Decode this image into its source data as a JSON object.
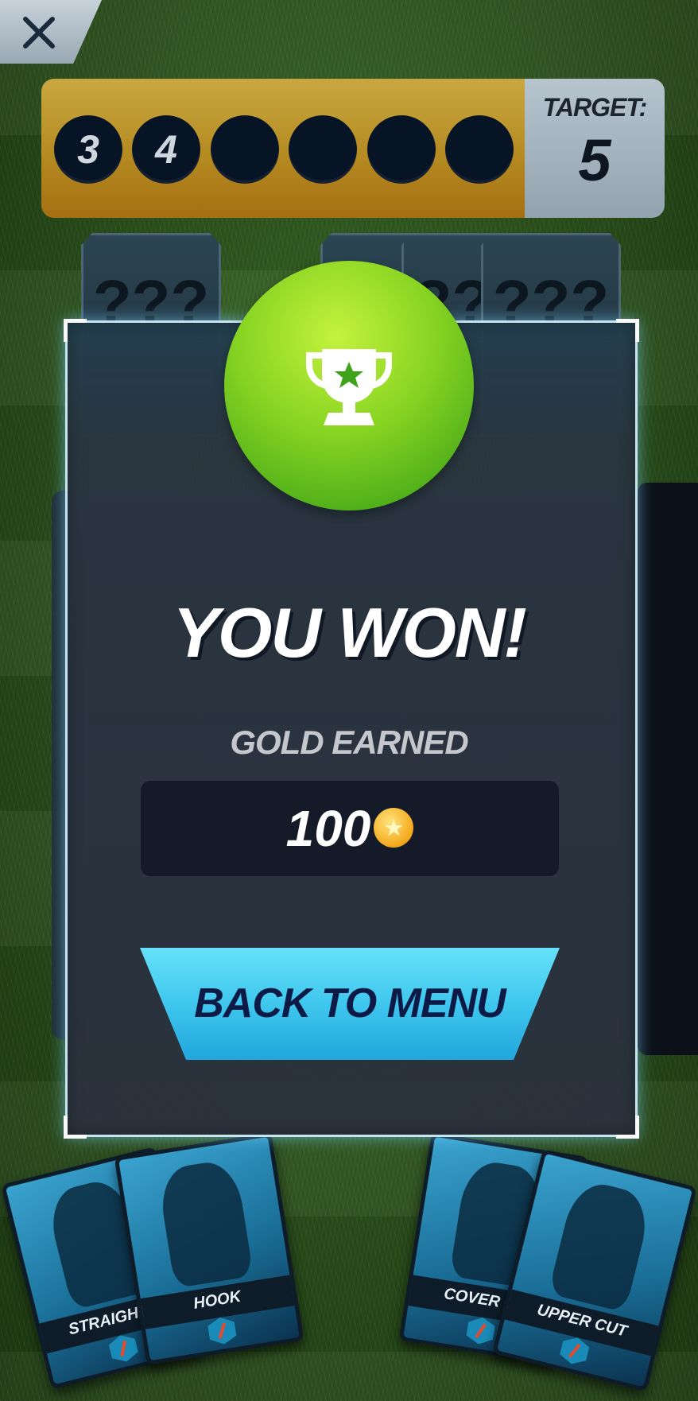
{
  "score_bar": {
    "balls": [
      "3",
      "4",
      "",
      "",
      "",
      ""
    ],
    "target_label": "TARGET:",
    "target_value": "5"
  },
  "hidden_cards": [
    "???",
    "???",
    "???",
    "???"
  ],
  "modal": {
    "title": "YOU WON!",
    "gold_label": "GOLD EARNED",
    "gold_amount": "100",
    "button_label": "BACK TO MENU"
  },
  "hand_cards": [
    {
      "label": "STRAIGHT D"
    },
    {
      "label": "HOOK"
    },
    {
      "label": "COVER DR"
    },
    {
      "label": "UPPER CUT"
    }
  ],
  "colors": {
    "accent_green": "#86d322",
    "button_cyan": "#3fc7ee",
    "score_gold": "#b58b22"
  },
  "icons": [
    "close-icon",
    "trophy-icon",
    "coin-icon"
  ]
}
